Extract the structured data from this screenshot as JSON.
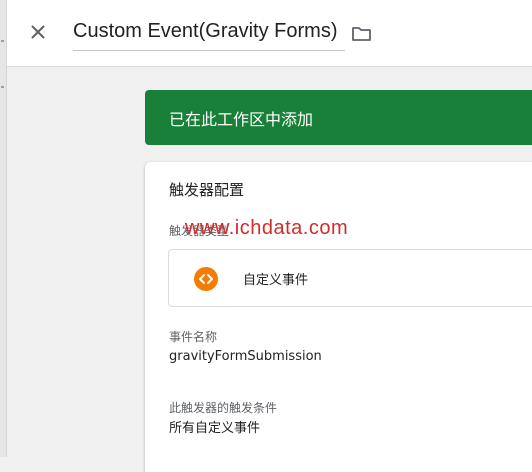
{
  "header": {
    "close_icon": "close-icon",
    "title": "Custom Event(Gravity Forms)",
    "folder_icon": "folder-icon"
  },
  "banner": {
    "text": "已在此工作区中添加",
    "color": "#188038"
  },
  "card": {
    "title": "触发器配置",
    "trigger_type": {
      "label": "触发器类型",
      "value": "自定义事件",
      "icon": "code-brackets-icon",
      "icon_color": "#f57c00"
    },
    "event_name": {
      "label": "事件名称",
      "value": "gravityFormSubmission"
    },
    "fire_on": {
      "label": "此触发器的触发条件",
      "value": "所有自定义事件"
    }
  },
  "watermark": {
    "text": "www.ichdata.com",
    "color": "#d42a2a"
  }
}
